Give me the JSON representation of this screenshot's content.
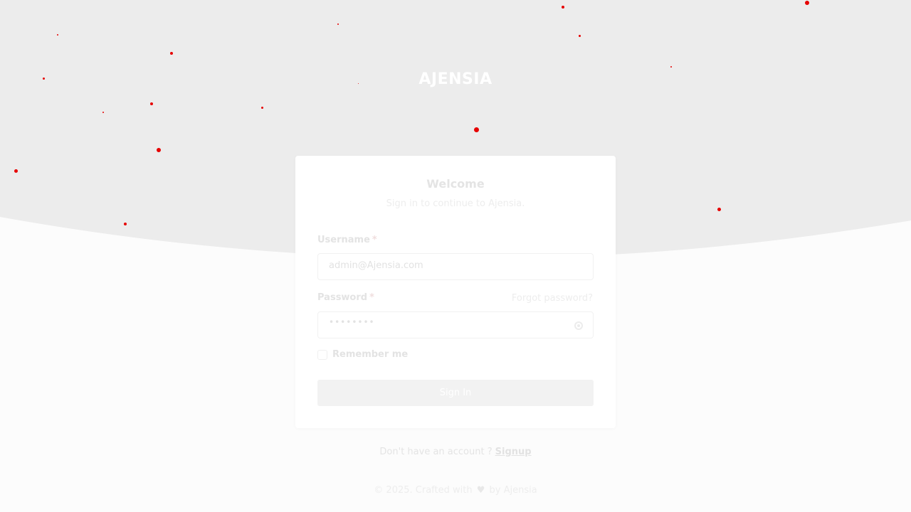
{
  "brand": {
    "name": "AJENSIA"
  },
  "login_card": {
    "title": "Welcome",
    "subtitle": "Sign in to continue to Ajensia.",
    "username": {
      "label": "Username",
      "required_mark": "*",
      "value": "admin@Ajensia.com"
    },
    "password": {
      "label": "Password",
      "required_mark": "*",
      "value": "••••••••",
      "forgot_link": "Forgot password?",
      "toggle_icon": "eye-icon"
    },
    "remember_me": {
      "label": "Remember me",
      "checked": false
    },
    "submit_label": "Sign In"
  },
  "signup": {
    "prompt": "Don't have an account ?",
    "link": "Signup"
  },
  "footer": {
    "prefix": "© 2025. Crafted with",
    "heart": "♥",
    "suffix": "by Ajensia"
  },
  "colors": {
    "accent": "#e60000",
    "hero_bg": "#eeeeee",
    "page_bg": "#fcfcfc",
    "card_bg": "#ffffff"
  }
}
